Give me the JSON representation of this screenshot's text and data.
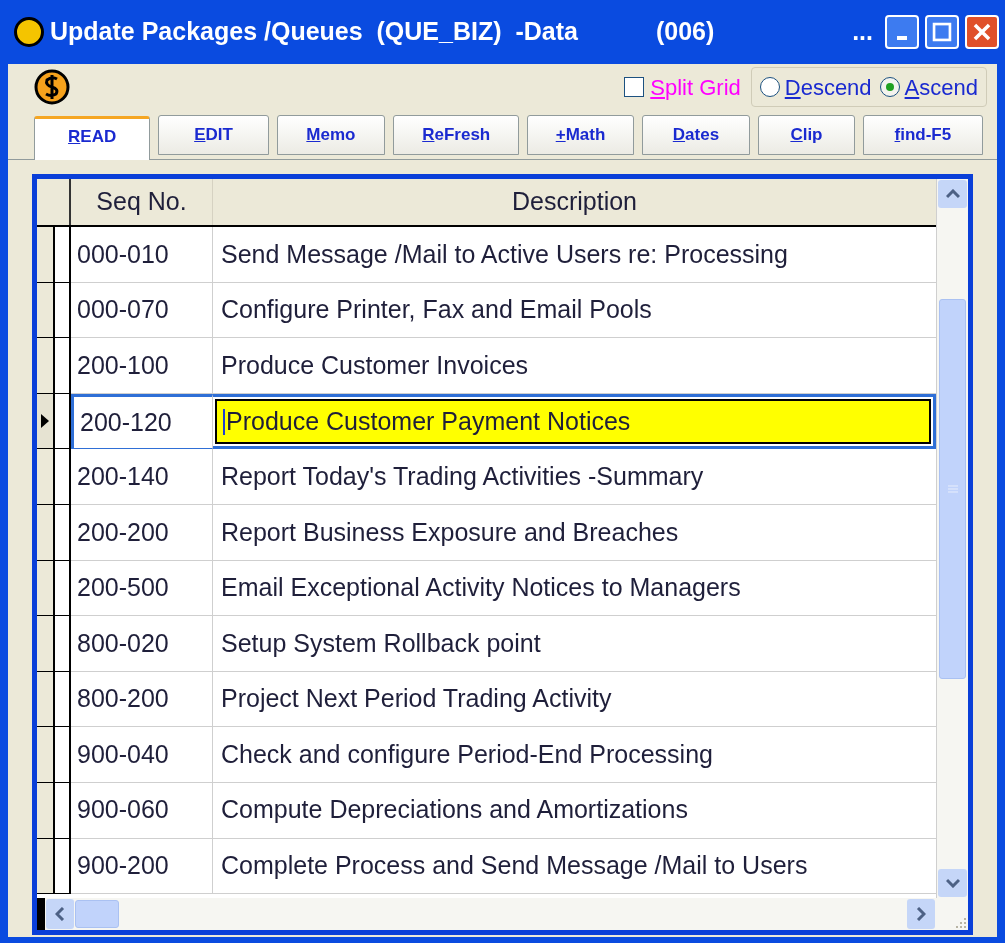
{
  "window": {
    "title": "Update Packages /Queues  (QUE_BIZ)  -Data",
    "count": "(006)",
    "ellipsis": "..."
  },
  "options": {
    "split_grid": {
      "label": "Split Grid",
      "checked": false
    },
    "sort": [
      {
        "label": "Descend",
        "selected": false
      },
      {
        "label": "Ascend",
        "selected": true
      }
    ]
  },
  "tabs": [
    {
      "label": "READ",
      "selected": true
    },
    {
      "label": "EDIT",
      "selected": false
    },
    {
      "label": "Memo",
      "selected": false
    },
    {
      "label": "ReFresh",
      "selected": false
    },
    {
      "label": "+Math",
      "selected": false
    },
    {
      "label": "Dates",
      "selected": false
    },
    {
      "label": "Clip",
      "selected": false
    },
    {
      "label": "find-F5",
      "selected": false
    }
  ],
  "table": {
    "columns": [
      "Seq No.",
      "Description"
    ],
    "rows": [
      {
        "seq": "000-010",
        "description": "Send Message /Mail to Active Users re: Processing",
        "selected": false
      },
      {
        "seq": "000-070",
        "description": "Configure Printer, Fax and Email Pools",
        "selected": false
      },
      {
        "seq": "200-100",
        "description": "Produce Customer Invoices",
        "selected": false
      },
      {
        "seq": "200-120",
        "description": "Produce Customer Payment Notices",
        "selected": true
      },
      {
        "seq": "200-140",
        "description": "Report Today's Trading Activities -Summary",
        "selected": false
      },
      {
        "seq": "200-200",
        "description": "Report Business Exposure and Breaches",
        "selected": false
      },
      {
        "seq": "200-500",
        "description": "Email Exceptional Activity Notices to Managers",
        "selected": false
      },
      {
        "seq": "800-020",
        "description": "Setup System Rollback point",
        "selected": false
      },
      {
        "seq": "800-200",
        "description": "Project Next Period Trading Activity",
        "selected": false
      },
      {
        "seq": "900-040",
        "description": "Check and configure Period-End Processing",
        "selected": false
      },
      {
        "seq": "900-060",
        "description": "Compute Depreciations and Amortizations",
        "selected": false
      },
      {
        "seq": "900-200",
        "description": "Complete Process and Send Message /Mail to Users",
        "selected": false
      }
    ]
  }
}
